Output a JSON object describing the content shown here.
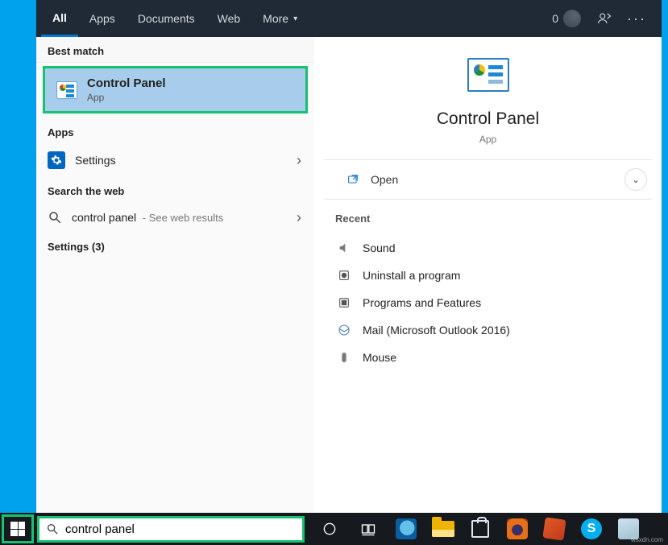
{
  "header": {
    "tabs": [
      "All",
      "Apps",
      "Documents",
      "Web",
      "More"
    ],
    "active": 0,
    "points": "0"
  },
  "left": {
    "best_match_label": "Best match",
    "best_match": {
      "title": "Control Panel",
      "subtitle": "App"
    },
    "apps_label": "Apps",
    "apps_item": "Settings",
    "search_web_label": "Search the web",
    "web_query": "control panel",
    "web_suffix": " - See web results",
    "settings_label": "Settings (3)"
  },
  "preview": {
    "title": "Control Panel",
    "subtitle": "App",
    "open_label": "Open",
    "recent_label": "Recent",
    "recent": [
      "Sound",
      "Uninstall a program",
      "Programs and Features",
      "Mail (Microsoft Outlook 2016)",
      "Mouse"
    ]
  },
  "taskbar": {
    "search_value": "control panel"
  },
  "watermark": "wsxdn.com"
}
